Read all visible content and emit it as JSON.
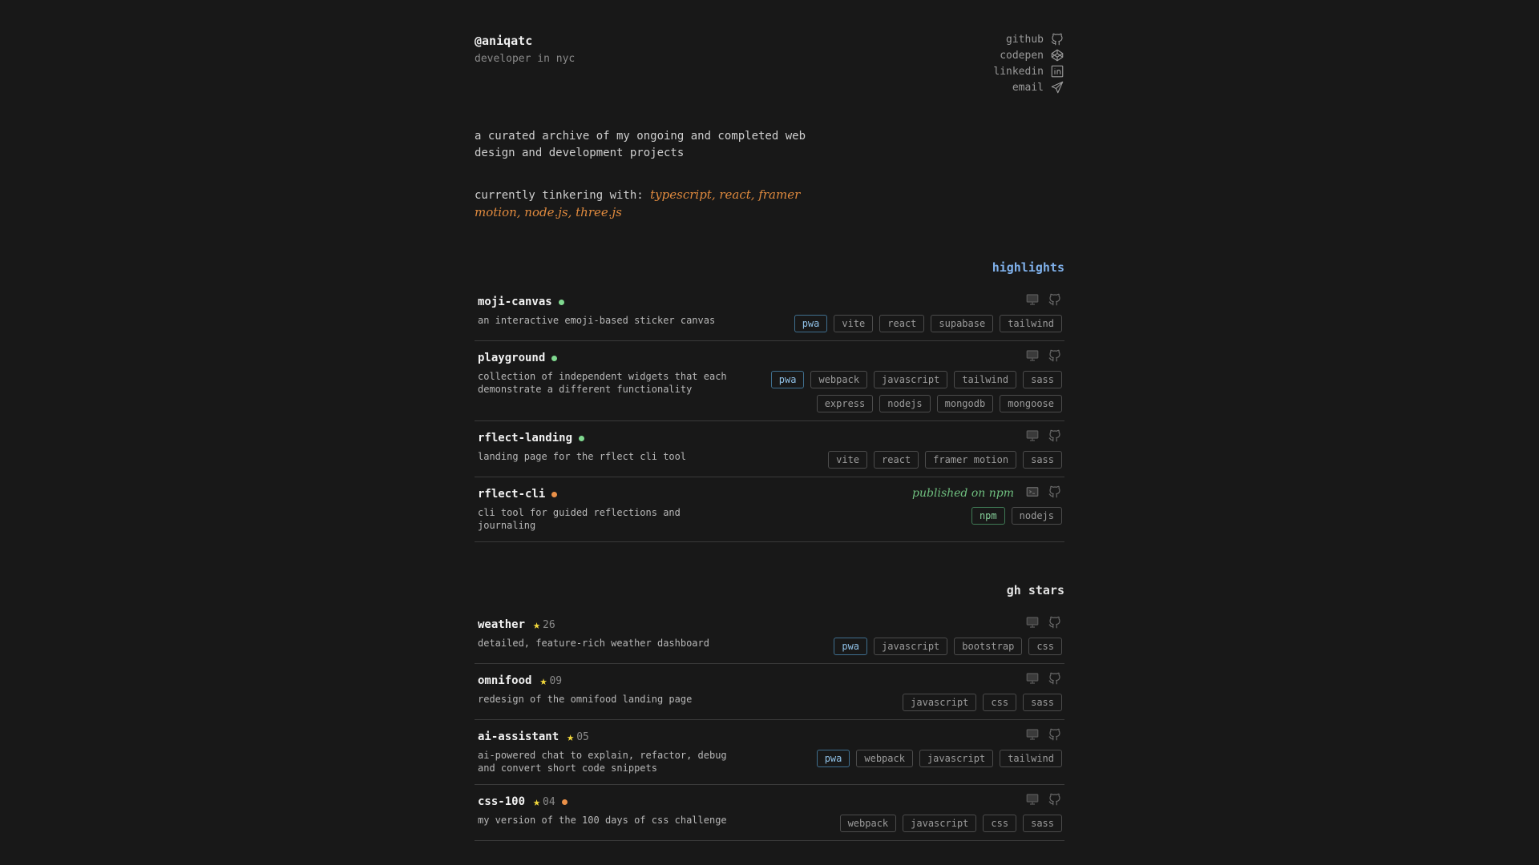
{
  "header": {
    "handle": "@aniqatc",
    "subtitle": "developer in nyc"
  },
  "social": [
    {
      "label": "github",
      "icon": "github-icon"
    },
    {
      "label": "codepen",
      "icon": "codepen-icon"
    },
    {
      "label": "linkedin",
      "icon": "linkedin-icon"
    },
    {
      "label": "email",
      "icon": "send-icon"
    }
  ],
  "intro": "a curated archive of my ongoing and completed web design and development projects",
  "tinkering": {
    "label": "currently tinkering with:",
    "tech": "typescript, react, framer motion, node.js, three.js"
  },
  "colors": {
    "background": "#181818",
    "highlights_title": "#7fb0ea",
    "handwritten_accent": "#e08a3e",
    "status_active": "#7fd88f",
    "status_wip": "#ea9048",
    "star": "#f2d83b",
    "pwa_tag": "#8fc0e6",
    "npm_tag": "#86d09a"
  },
  "highlights": {
    "title": "highlights",
    "items": [
      {
        "name": "moji-canvas",
        "status": "green",
        "description": "an interactive emoji-based sticker canvas",
        "icons": [
          "monitor-icon",
          "github-icon"
        ],
        "tags": [
          "pwa",
          "vite",
          "react",
          "supabase",
          "tailwind"
        ]
      },
      {
        "name": "playground",
        "status": "green",
        "description": "collection of independent widgets that each demonstrate a different functionality",
        "icons": [
          "monitor-icon",
          "github-icon"
        ],
        "tags": [
          "pwa",
          "webpack",
          "javascript",
          "tailwind",
          "sass",
          "express",
          "nodejs",
          "mongodb",
          "mongoose"
        ]
      },
      {
        "name": "rflect-landing",
        "status": "green",
        "description": "landing page for the rflect cli tool",
        "icons": [
          "monitor-icon",
          "github-icon"
        ],
        "tags": [
          "vite",
          "react",
          "framer motion",
          "sass"
        ]
      },
      {
        "name": "rflect-cli",
        "status": "orange",
        "description": "cli tool for guided reflections and journaling",
        "note": "published on npm",
        "icons": [
          "terminal-icon",
          "github-icon"
        ],
        "tags": [
          "npm",
          "nodejs"
        ]
      }
    ]
  },
  "gh_stars": {
    "title": "gh stars",
    "items": [
      {
        "name": "weather",
        "stars": "26",
        "description": "detailed, feature-rich weather dashboard",
        "icons": [
          "monitor-icon",
          "github-icon"
        ],
        "tags": [
          "pwa",
          "javascript",
          "bootstrap",
          "css"
        ]
      },
      {
        "name": "omnifood",
        "stars": "09",
        "description": "redesign of the omnifood landing page",
        "icons": [
          "monitor-icon",
          "github-icon"
        ],
        "tags": [
          "javascript",
          "css",
          "sass"
        ]
      },
      {
        "name": "ai-assistant",
        "stars": "05",
        "description": "ai-powered chat to explain, refactor, debug and convert short code snippets",
        "icons": [
          "monitor-icon",
          "github-icon"
        ],
        "tags": [
          "pwa",
          "webpack",
          "javascript",
          "tailwind"
        ]
      },
      {
        "name": "css-100",
        "stars": "04",
        "status": "orange",
        "description": "my version of the 100 days of css challenge",
        "icons": [
          "monitor-icon",
          "github-icon"
        ],
        "tags": [
          "webpack",
          "javascript",
          "css",
          "sass"
        ]
      }
    ]
  }
}
